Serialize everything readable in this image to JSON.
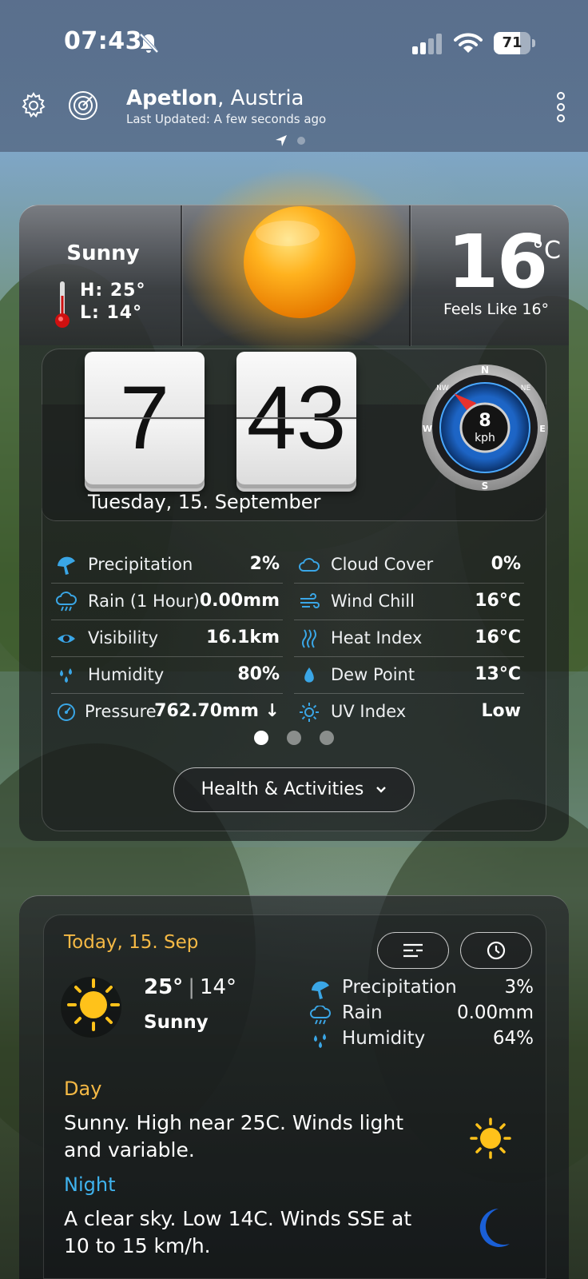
{
  "status_bar": {
    "time": "07:43",
    "battery": "71",
    "battery_level": 0.71
  },
  "header": {
    "city": "Apetlon",
    "country": ", Austria",
    "updated": "Last Updated: A few seconds ago"
  },
  "current": {
    "condition": "Sunny",
    "high": "H: 25°",
    "low": "L: 14°",
    "temperature": "16",
    "unit": "°C",
    "feels_like": "Feels Like 16°",
    "clock_hours": "7",
    "clock_minutes": "43",
    "date": "Tuesday, 15. September",
    "wind_speed": "8",
    "wind_unit": "kph",
    "wind_direction": "NW",
    "compass_labels": {
      "n": "N",
      "ne": "NE",
      "e": "E",
      "s": "S",
      "w": "W",
      "nw": "NW"
    }
  },
  "details": [
    {
      "label": "Precipitation",
      "value": "2%",
      "icon": "umbrella-icon"
    },
    {
      "label": "Cloud Cover",
      "value": "0%",
      "icon": "cloud-icon"
    },
    {
      "label": "Rain (1 Hour)",
      "value": "0.00mm",
      "icon": "rain-cloud-icon"
    },
    {
      "label": "Wind Chill",
      "value": "16°C",
      "icon": "wind-icon"
    },
    {
      "label": "Visibility",
      "value": "16.1km",
      "icon": "eye-icon"
    },
    {
      "label": "Heat Index",
      "value": "16°C",
      "icon": "heat-waves-icon"
    },
    {
      "label": "Humidity",
      "value": "80%",
      "icon": "drops-icon"
    },
    {
      "label": "Dew Point",
      "value": "13°C",
      "icon": "drop-icon"
    },
    {
      "label": "Pressure",
      "value": "762.70mm ↓",
      "icon": "gauge-icon"
    },
    {
      "label": "UV Index",
      "value": "Low",
      "icon": "sun-outline-icon"
    }
  ],
  "health_button": "Health & Activities",
  "forecast": {
    "date": "Today, 15. Sep",
    "high": "25°",
    "low": "14°",
    "condition": "Sunny",
    "precipitation_label": "Precipitation",
    "precipitation": "3%",
    "rain_label": "Rain",
    "rain": "0.00mm",
    "humidity_label": "Humidity",
    "humidity": "64%",
    "day_heading": "Day",
    "day_text": "Sunny. High near 25C. Winds light and variable.",
    "night_heading": "Night",
    "night_text": "A clear sky. Low 14C. Winds SSE at 10 to 15 km/h."
  },
  "colors": {
    "accent_orange": "#f5b945",
    "accent_blue": "#3fb3ee",
    "icon_blue": "#3aa6e6"
  }
}
